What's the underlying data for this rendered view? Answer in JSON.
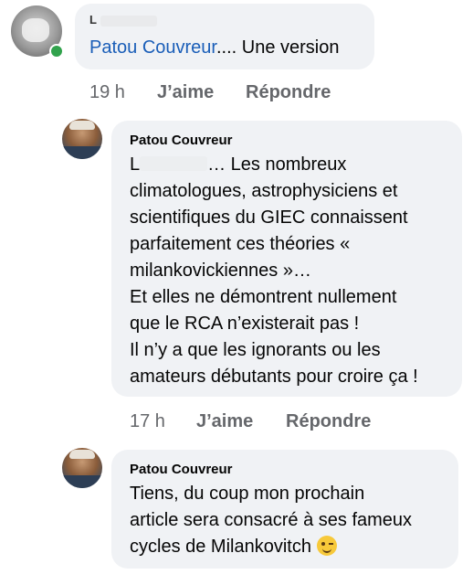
{
  "comments": [
    {
      "author": "L",
      "mention": "Patou Couvreur",
      "text_after_mention": ".... Une version",
      "time": "19 h",
      "like_label": "J’aime",
      "reply_label": "Répondre"
    },
    {
      "author": "Patou Couvreur",
      "text_prefix": "L",
      "lines": [
        "… Les nombreux",
        "climatologues, astrophysiciens et",
        "scientifiques du GIEC connaissent",
        "parfaitement ces théories «",
        "milankovickiennes »…",
        "Et elles ne démontrent nullement",
        "que le RCA n’existerait pas !",
        "Il n’y a que les ignorants ou les",
        "amateurs débutants pour croire ça !"
      ],
      "time": "17 h",
      "like_label": "J’aime",
      "reply_label": "Répondre"
    },
    {
      "author": "Patou Couvreur",
      "lines": [
        "Tiens, du coup mon prochain",
        "article sera consacré à ses fameux",
        "cycles de Milankovitch"
      ],
      "emoji": "winking-face-icon"
    }
  ]
}
